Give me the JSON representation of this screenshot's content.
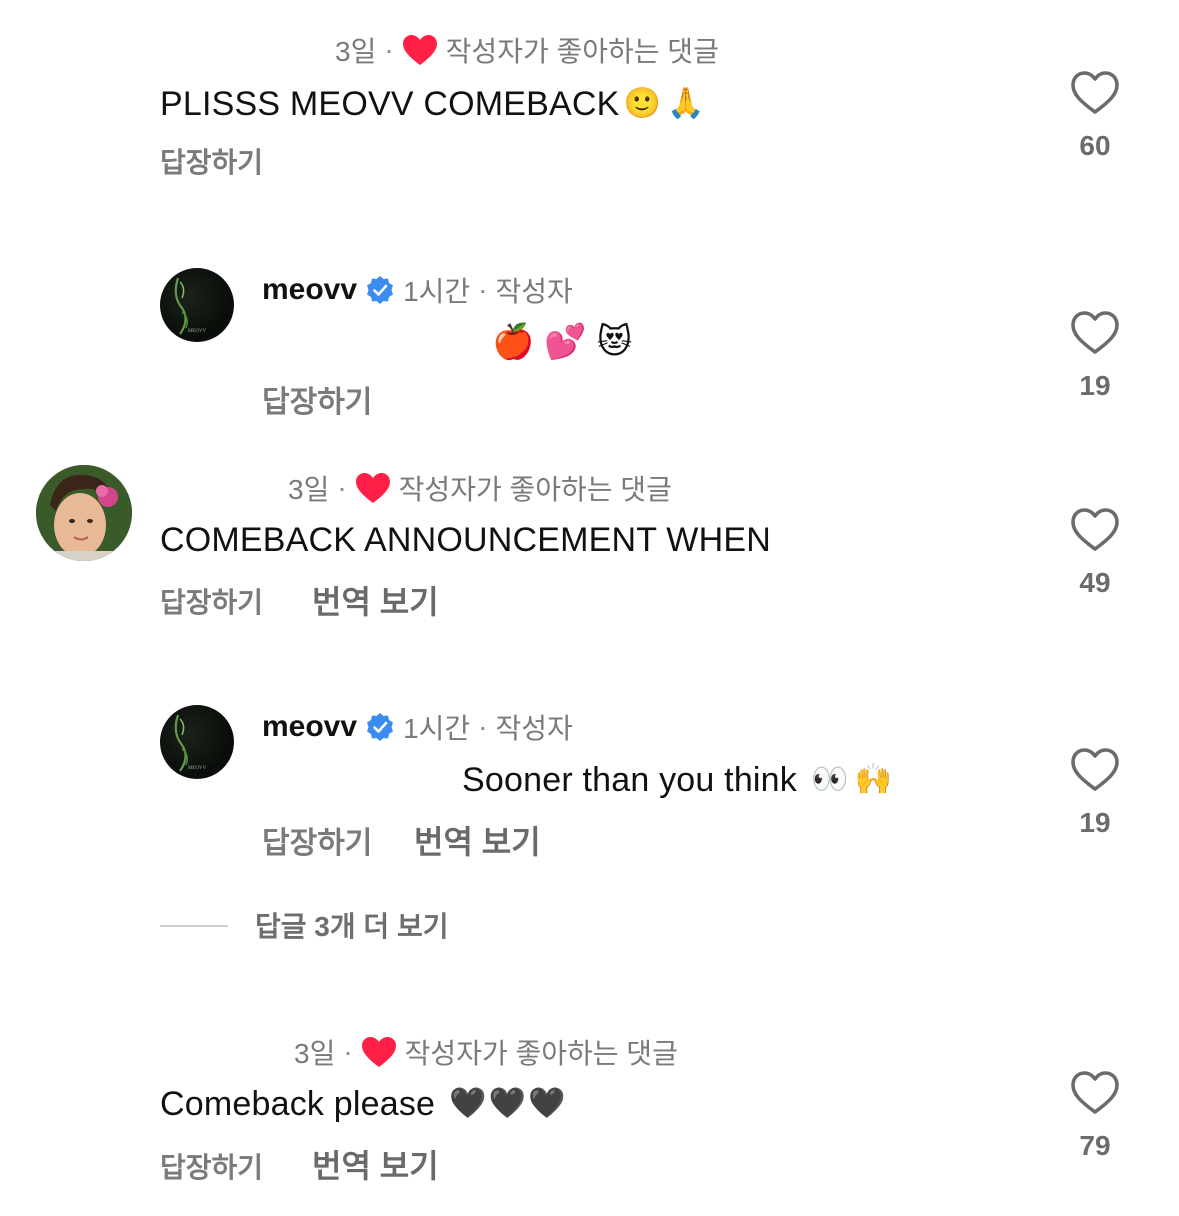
{
  "comments": [
    {
      "meta": {
        "time": "3일",
        "sep": "·",
        "liked_label": "작성자가 좋아하는 댓글"
      },
      "text": "PLISSS MEOVV COMEBACK",
      "emojis": [
        "🙂",
        "🙏"
      ],
      "reply_label": "답장하기",
      "likes": "60"
    },
    {
      "username": "meovv",
      "meta": {
        "time": "1시간",
        "sep": "·",
        "author_label": "작성자"
      },
      "text": "",
      "emojis": [
        "🍎",
        "💕",
        "😻"
      ],
      "reply_label": "답장하기",
      "likes": "19"
    },
    {
      "meta": {
        "time": "3일",
        "sep": "·",
        "liked_label": "작성자가 좋아하는 댓글"
      },
      "text": "COMEBACK ANNOUNCEMENT WHEN",
      "reply_label": "답장하기",
      "translate_label": "번역 보기",
      "likes": "49"
    },
    {
      "username": "meovv",
      "meta": {
        "time": "1시간",
        "sep": "·",
        "author_label": "작성자"
      },
      "text": "Sooner than you think",
      "emojis": [
        "👀",
        "🙌"
      ],
      "reply_label": "답장하기",
      "translate_label": "번역 보기",
      "likes": "19"
    },
    {
      "meta": {
        "time": "3일",
        "sep": "·",
        "liked_label": "작성자가 좋아하는 댓글"
      },
      "text": "Comeback please",
      "emojis": [
        "🖤",
        "🖤",
        "🖤"
      ],
      "reply_label": "답장하기",
      "translate_label": "번역 보기",
      "likes": "79"
    }
  ],
  "more_replies": "답글 3개 더 보기",
  "icons": {
    "like": "heart-outline-icon",
    "liked_by_author": "red-heart-icon",
    "verified": "verified-badge-icon"
  },
  "colors": {
    "liked_red": "#ff1f47",
    "verified_blue": "#3b8cf0",
    "muted_text": "#7a7a7a"
  }
}
